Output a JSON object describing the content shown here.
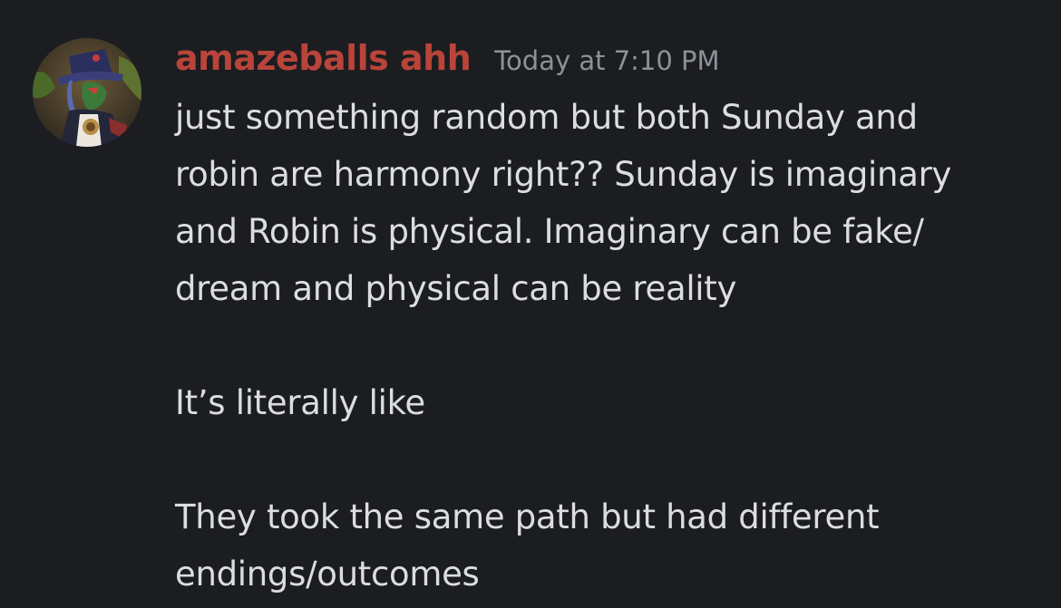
{
  "message": {
    "author": "amazeballs ahh",
    "timestamp": "Today at 7:10 PM",
    "avatar_icon": "user-avatar",
    "author_color": "#b9443a",
    "paragraphs": {
      "p1_line1": "just something random but both Sunday and",
      "p1_line2": "robin are harmony right?? Sunday is imaginary",
      "p1_line3": "and Robin is physical. Imaginary can be fake/",
      "p1_line4": "dream and physical can be reality",
      "p2_line1": "It’s literally like",
      "p3_line1": "They took the same path but had different",
      "p3_line2": "endings/outcomes"
    }
  }
}
